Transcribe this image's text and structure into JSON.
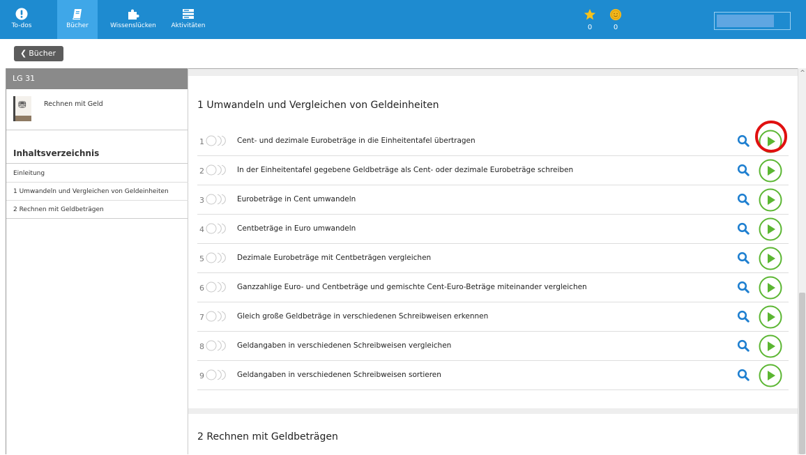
{
  "nav": {
    "items": [
      {
        "label": "To-dos",
        "icon": "exclamation-icon"
      },
      {
        "label": "Bücher",
        "icon": "book-icon",
        "active": true
      },
      {
        "label": "Wissenslücken",
        "icon": "puzzle-icon"
      },
      {
        "label": "Aktivitäten",
        "icon": "list-icon"
      }
    ],
    "stars": "0",
    "coins": "0"
  },
  "back_button": "Bücher",
  "sidebar": {
    "header": "LG 31",
    "book_title": "Rechnen mit Geld",
    "toc_heading": "Inhaltsverzeichnis",
    "toc": [
      "Einleitung",
      "1 Umwandeln und Vergleichen von Geldeinheiten",
      "2 Rechnen mit Geldbeträgen"
    ]
  },
  "sections": [
    {
      "title": "1  Umwandeln und Vergleichen von Geldeinheiten",
      "exercises": [
        {
          "num": "1",
          "text": "Cent- und dezimale Eurobeträge in die Einheitentafel übertragen",
          "highlighted": true
        },
        {
          "num": "2",
          "text": "In der Einheitentafel gegebene Geldbeträge als Cent- oder dezimale Eurobeträge schreiben"
        },
        {
          "num": "3",
          "text": "Eurobeträge in Cent umwandeln"
        },
        {
          "num": "4",
          "text": "Centbeträge in Euro umwandeln"
        },
        {
          "num": "5",
          "text": "Dezimale Eurobeträge mit Centbeträgen vergleichen"
        },
        {
          "num": "6",
          "text": "Ganzzahlige Euro- und Centbeträge und gemischte Cent-Euro-Beträge miteinander vergleichen"
        },
        {
          "num": "7",
          "text": "Gleich große Geldbeträge in verschiedenen Schreibweisen erkennen"
        },
        {
          "num": "8",
          "text": "Geldangaben in verschiedenen Schreibweisen vergleichen"
        },
        {
          "num": "9",
          "text": "Geldangaben in verschiedenen Schreibweisen sortieren"
        }
      ]
    },
    {
      "title": "2  Rechnen mit Geldbeträgen"
    }
  ],
  "colors": {
    "nav_bg": "#1e8bd0",
    "nav_active": "#3fa7e8",
    "search_icon": "#1e7fd0",
    "play_icon": "#5bb632",
    "highlight": "#e01010"
  }
}
